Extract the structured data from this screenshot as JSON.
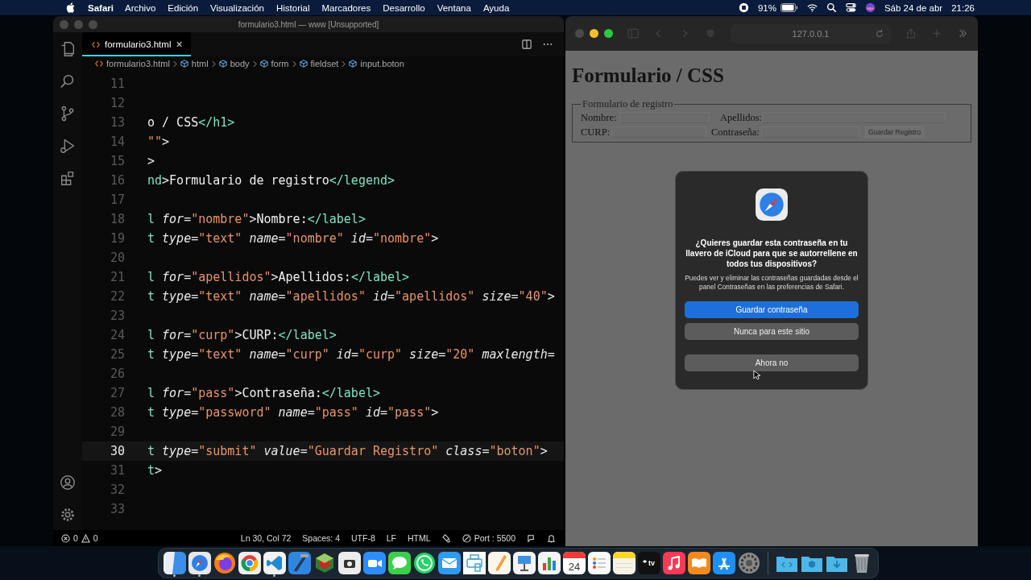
{
  "menubar": {
    "app": "Safari",
    "menus": [
      "Archivo",
      "Edición",
      "Visualización",
      "Historial",
      "Marcadores",
      "Desarrollo",
      "Ventana",
      "Ayuda"
    ],
    "battery": "91%",
    "date": "Sáb 24 de abr",
    "time": "21:26"
  },
  "editor": {
    "title": "formulario3.html — www [Unsupported]",
    "tabs": [
      {
        "label": "formulario3.html",
        "close": "×",
        "selected": true
      }
    ],
    "breadcrumbs": [
      {
        "label": "formulario3.html",
        "kind": "file"
      },
      {
        "label": "html",
        "kind": "element"
      },
      {
        "label": "body",
        "kind": "element"
      },
      {
        "label": "form",
        "kind": "element"
      },
      {
        "label": "fieldset",
        "kind": "element"
      },
      {
        "label": "input.boton",
        "kind": "element"
      }
    ],
    "lines": [
      {
        "number": "11",
        "current": false
      },
      {
        "number": "12",
        "current": false
      },
      {
        "number": "13",
        "current": false,
        "tokens": [
          {
            "kind": "text",
            "text": "o / CSS"
          },
          {
            "kind": "tag",
            "text": "</h1>"
          }
        ]
      },
      {
        "number": "14",
        "current": false,
        "tokens": [
          {
            "kind": "str",
            "text": "\"\""
          },
          {
            "kind": "punct",
            "text": ">"
          }
        ]
      },
      {
        "number": "15",
        "current": false,
        "tokens": [
          {
            "kind": "punct",
            "text": ">"
          }
        ]
      },
      {
        "number": "16",
        "current": false,
        "tokens": [
          {
            "kind": "tag",
            "text": "nd"
          },
          {
            "kind": "punct",
            "text": ">"
          },
          {
            "kind": "text",
            "text": "Formulario de registro"
          },
          {
            "kind": "tag",
            "text": "</legend>"
          }
        ]
      },
      {
        "number": "17",
        "current": false
      },
      {
        "number": "18",
        "current": false,
        "tokens": [
          {
            "kind": "tag",
            "text": "l"
          },
          {
            "kind": "attr",
            "text": " for"
          },
          {
            "kind": "punct",
            "text": "="
          },
          {
            "kind": "str",
            "text": "\"nombre\""
          },
          {
            "kind": "punct",
            "text": ">"
          },
          {
            "kind": "text",
            "text": "Nombre:"
          },
          {
            "kind": "tag",
            "text": "</label>"
          }
        ]
      },
      {
        "number": "19",
        "current": false,
        "tokens": [
          {
            "kind": "tag",
            "text": "t"
          },
          {
            "kind": "attr",
            "text": " type"
          },
          {
            "kind": "punct",
            "text": "="
          },
          {
            "kind": "str",
            "text": "\"text\""
          },
          {
            "kind": "attr",
            "text": " name"
          },
          {
            "kind": "punct",
            "text": "="
          },
          {
            "kind": "str",
            "text": "\"nombre\""
          },
          {
            "kind": "attr",
            "text": " id"
          },
          {
            "kind": "punct",
            "text": "="
          },
          {
            "kind": "str",
            "text": "\"nombre\""
          },
          {
            "kind": "punct",
            "text": ">"
          }
        ]
      },
      {
        "number": "20",
        "current": false
      },
      {
        "number": "21",
        "current": false,
        "tokens": [
          {
            "kind": "tag",
            "text": "l"
          },
          {
            "kind": "attr",
            "text": " for"
          },
          {
            "kind": "punct",
            "text": "="
          },
          {
            "kind": "str",
            "text": "\"apellidos\""
          },
          {
            "kind": "punct",
            "text": ">"
          },
          {
            "kind": "text",
            "text": "Apellidos:"
          },
          {
            "kind": "tag",
            "text": "</label>"
          }
        ]
      },
      {
        "number": "22",
        "current": false,
        "tokens": [
          {
            "kind": "tag",
            "text": "t"
          },
          {
            "kind": "attr",
            "text": " type"
          },
          {
            "kind": "punct",
            "text": "="
          },
          {
            "kind": "str",
            "text": "\"text\""
          },
          {
            "kind": "attr",
            "text": " name"
          },
          {
            "kind": "punct",
            "text": "="
          },
          {
            "kind": "str",
            "text": "\"apellidos\""
          },
          {
            "kind": "attr",
            "text": " id"
          },
          {
            "kind": "punct",
            "text": "="
          },
          {
            "kind": "str",
            "text": "\"apellidos\""
          },
          {
            "kind": "attr",
            "text": " size"
          },
          {
            "kind": "punct",
            "text": "="
          },
          {
            "kind": "str",
            "text": "\"40\""
          },
          {
            "kind": "punct",
            "text": ">"
          }
        ]
      },
      {
        "number": "23",
        "current": false
      },
      {
        "number": "24",
        "current": false,
        "tokens": [
          {
            "kind": "tag",
            "text": "l"
          },
          {
            "kind": "attr",
            "text": " for"
          },
          {
            "kind": "punct",
            "text": "="
          },
          {
            "kind": "str",
            "text": "\"curp\""
          },
          {
            "kind": "punct",
            "text": ">"
          },
          {
            "kind": "text",
            "text": "CURP:"
          },
          {
            "kind": "tag",
            "text": "</label>"
          }
        ]
      },
      {
        "number": "25",
        "current": false,
        "tokens": [
          {
            "kind": "tag",
            "text": "t"
          },
          {
            "kind": "attr",
            "text": " type"
          },
          {
            "kind": "punct",
            "text": "="
          },
          {
            "kind": "str",
            "text": "\"text\""
          },
          {
            "kind": "attr",
            "text": " name"
          },
          {
            "kind": "punct",
            "text": "="
          },
          {
            "kind": "str",
            "text": "\"curp\""
          },
          {
            "kind": "attr",
            "text": " id"
          },
          {
            "kind": "punct",
            "text": "="
          },
          {
            "kind": "str",
            "text": "\"curp\""
          },
          {
            "kind": "attr",
            "text": " size"
          },
          {
            "kind": "punct",
            "text": "="
          },
          {
            "kind": "str",
            "text": "\"20\""
          },
          {
            "kind": "attr",
            "text": " maxlength"
          },
          {
            "kind": "punct",
            "text": "="
          }
        ]
      },
      {
        "number": "26",
        "current": false
      },
      {
        "number": "27",
        "current": false,
        "tokens": [
          {
            "kind": "tag",
            "text": "l"
          },
          {
            "kind": "attr",
            "text": " for"
          },
          {
            "kind": "punct",
            "text": "="
          },
          {
            "kind": "str",
            "text": "\"pass\""
          },
          {
            "kind": "punct",
            "text": ">"
          },
          {
            "kind": "text",
            "text": "Contraseña:"
          },
          {
            "kind": "tag",
            "text": "</label>"
          }
        ]
      },
      {
        "number": "28",
        "current": false,
        "tokens": [
          {
            "kind": "tag",
            "text": "t"
          },
          {
            "kind": "attr",
            "text": " type"
          },
          {
            "kind": "punct",
            "text": "="
          },
          {
            "kind": "str",
            "text": "\"password\""
          },
          {
            "kind": "attr",
            "text": " name"
          },
          {
            "kind": "punct",
            "text": "="
          },
          {
            "kind": "str",
            "text": "\"pass\""
          },
          {
            "kind": "attr",
            "text": " id"
          },
          {
            "kind": "punct",
            "text": "="
          },
          {
            "kind": "str",
            "text": "\"pass\""
          },
          {
            "kind": "punct",
            "text": ">"
          }
        ]
      },
      {
        "number": "29",
        "current": false
      },
      {
        "number": "30",
        "current": true,
        "tokens": [
          {
            "kind": "tag",
            "text": "t"
          },
          {
            "kind": "attr",
            "text": " type"
          },
          {
            "kind": "punct",
            "text": "="
          },
          {
            "kind": "str",
            "text": "\"submit\""
          },
          {
            "kind": "attr",
            "text": " value"
          },
          {
            "kind": "punct",
            "text": "="
          },
          {
            "kind": "str",
            "text": "\"Guardar Registro\""
          },
          {
            "kind": "attr",
            "text": " class"
          },
          {
            "kind": "punct",
            "text": "="
          },
          {
            "kind": "str",
            "text": "\"boton\""
          },
          {
            "kind": "punct",
            "text": ">"
          }
        ]
      },
      {
        "number": "31",
        "current": false,
        "tokens": [
          {
            "kind": "tag",
            "text": "t"
          },
          {
            "kind": "punct",
            "text": ">"
          }
        ]
      },
      {
        "number": "32",
        "current": false
      },
      {
        "number": "33",
        "current": false
      }
    ],
    "status": {
      "errors": "0",
      "warnings": "0",
      "items": [
        "Ln 30, Col 72",
        "Spaces: 4",
        "UTF-8",
        "LF",
        "HTML"
      ],
      "port": "Port : 5500"
    }
  },
  "browser": {
    "address": "127.0.0.1",
    "heading": "Formulario / CSS",
    "legend": "Formulario de registro",
    "fields": [
      {
        "label": "Nombre:"
      },
      {
        "label": "Apellidos:"
      },
      {
        "label": "CURP:"
      },
      {
        "label": "Contraseña:"
      }
    ],
    "button": "Guardar Registro",
    "dialog": {
      "title": "¿Quieres guardar esta contraseña en tu llavero de iCloud para que se autorrellene en todos tus dispositivos?",
      "body": "Puedes ver y eliminar las contraseñas guardadas desde el panel Contraseñas en las preferencias de Safari.",
      "buttons": [
        {
          "label": "Guardar contraseña",
          "default": true
        },
        {
          "label": "Nunca para este sitio",
          "default": false
        },
        {
          "label": "Ahora no",
          "default": false
        }
      ]
    }
  },
  "dock": [
    {
      "kind": "finder",
      "running": true
    },
    {
      "kind": "safari",
      "running": true
    },
    {
      "kind": "firefox",
      "running": false
    },
    {
      "kind": "chrome",
      "running": false
    },
    {
      "kind": "vscode",
      "running": true
    },
    {
      "kind": "xcode",
      "running": false
    },
    {
      "kind": "cube",
      "running": false
    },
    {
      "kind": "screenshot",
      "running": false
    },
    {
      "kind": "zoom",
      "running": false
    },
    {
      "kind": "messages",
      "running": false
    },
    {
      "kind": "whatsapp",
      "running": false
    },
    {
      "kind": "mail",
      "running": false
    },
    {
      "kind": "printer",
      "running": false
    },
    {
      "kind": "pages",
      "running": false
    },
    {
      "kind": "keynote",
      "running": false
    },
    {
      "kind": "numbers",
      "running": false
    },
    {
      "kind": "calendar",
      "running": false,
      "day": "24"
    },
    {
      "kind": "reminders",
      "running": false
    },
    {
      "kind": "notes",
      "running": false
    },
    {
      "kind": "tv",
      "running": false,
      "label": "tv"
    },
    {
      "kind": "music",
      "running": false
    },
    {
      "kind": "books",
      "running": false
    },
    {
      "kind": "appstore",
      "running": false
    },
    {
      "kind": "settings",
      "running": false
    },
    {
      "kind": "separator"
    },
    {
      "kind": "folder-code",
      "running": false
    },
    {
      "kind": "folder-app",
      "running": false
    },
    {
      "kind": "folder-download",
      "running": false
    },
    {
      "kind": "trash",
      "running": false
    }
  ]
}
